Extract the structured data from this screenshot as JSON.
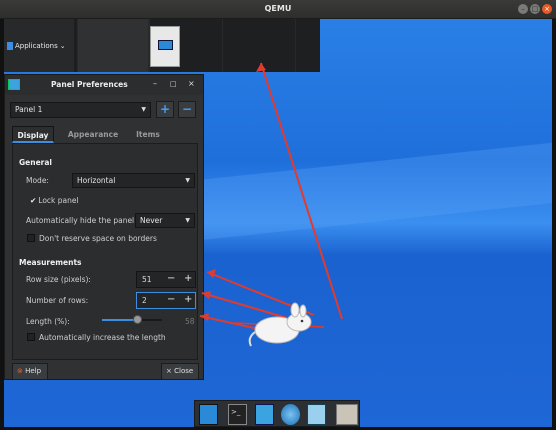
{
  "window": {
    "title": "QEMU"
  },
  "panel": {
    "applications_label": "Applications ",
    "applications_arrow": "⌄"
  },
  "dialog": {
    "title": "Panel Preferences",
    "panel_select": "Panel 1",
    "add_icon": "+",
    "remove_icon": "−",
    "tabs": [
      "Display",
      "Appearance",
      "Items"
    ],
    "general": {
      "header": "General",
      "mode_label": "Mode:",
      "mode_value": "Horizontal",
      "lock_panel": "Lock panel",
      "lock_checked": true,
      "autohide_label": "Automatically hide the panel:",
      "autohide_value": "Never",
      "reserve_label": "Don't reserve space on borders"
    },
    "measurements": {
      "header": "Measurements",
      "row_size_label": "Row size (pixels):",
      "row_size_value": "51",
      "rows_label": "Number of rows:",
      "rows_value": "2",
      "length_label": "Length (%):",
      "length_value": "58",
      "length_fraction": 0.58,
      "auto_length_label": "Automatically increase the length"
    },
    "help_label": "Help",
    "close_label": "Close"
  },
  "colors": {
    "accent": "#3d8ee0",
    "arrow": "#e23b2e",
    "close_button": "#e65a24"
  },
  "icons": [
    "minimize-icon",
    "maximize-icon",
    "close-icon",
    "panel-icon",
    "terminal-icon",
    "files-icon",
    "browser-icon",
    "search-icon",
    "folder-icon"
  ]
}
